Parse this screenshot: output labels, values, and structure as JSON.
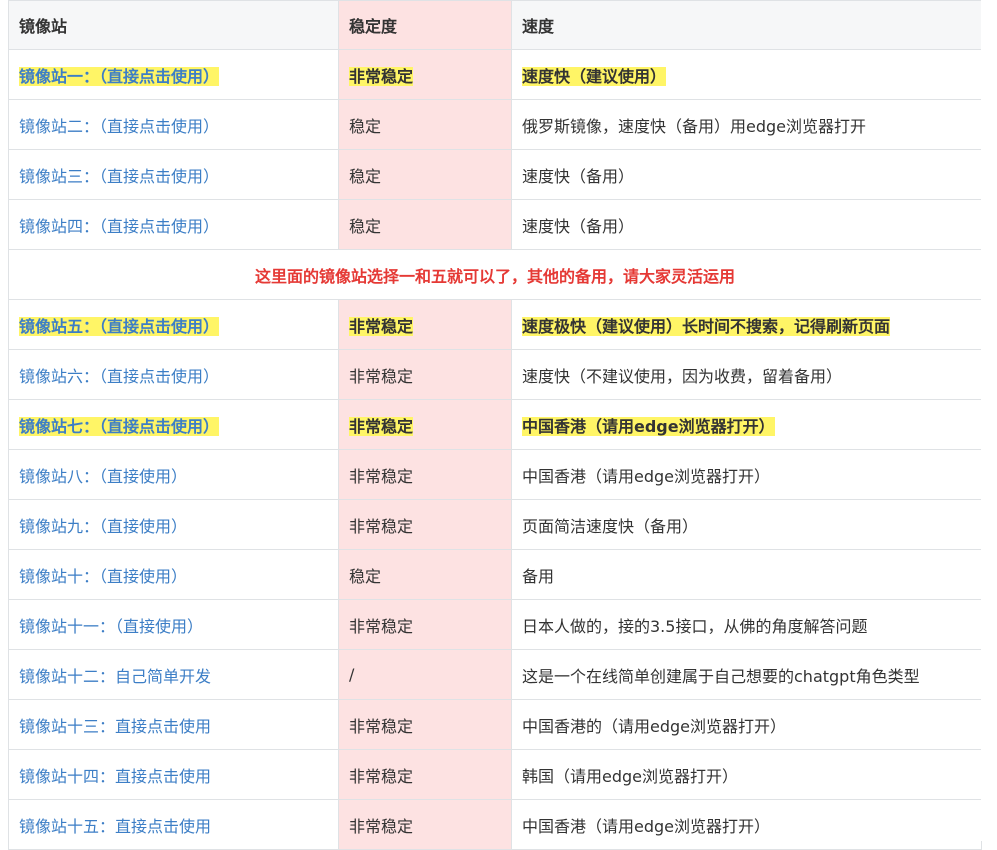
{
  "headers": {
    "mirror": "镜像站",
    "stability": "稳定度",
    "speed": "速度"
  },
  "rows": [
    {
      "name": "镜像站一：（直接点击使用）",
      "stability": "非常稳定",
      "speed": "速度快（建议使用）"
    },
    {
      "name": "镜像站二：（直接点击使用）",
      "stability": "稳定",
      "speed": "俄罗斯镜像，速度快（备用）用edge浏览器打开"
    },
    {
      "name": "镜像站三：（直接点击使用）",
      "stability": "稳定",
      "speed": "速度快（备用）"
    },
    {
      "name": "镜像站四：（直接点击使用）",
      "stability": "稳定",
      "speed": "速度快（备用）"
    },
    {
      "notice": "这里面的镜像站选择一和五就可以了，其他的备用，请大家灵活运用"
    },
    {
      "name": "镜像站五：（直接点击使用）",
      "stability": "非常稳定",
      "speed": "速度极快（建议使用）长时间不搜索，记得刷新页面"
    },
    {
      "name": "镜像站六：（直接点击使用）",
      "stability": "非常稳定",
      "speed": "速度快（不建议使用，因为收费，留着备用）"
    },
    {
      "name": "镜像站七：（直接点击使用）",
      "stability": "非常稳定",
      "speed": "中国香港（请用edge浏览器打开）"
    },
    {
      "name": "镜像站八：（直接使用）",
      "stability": "非常稳定",
      "speed": "中国香港（请用edge浏览器打开）"
    },
    {
      "name": "镜像站九：（直接使用）",
      "stability": "非常稳定",
      "speed": "页面简洁速度快（备用）"
    },
    {
      "name": "镜像站十：（直接使用）",
      "stability": "稳定",
      "speed": "备用"
    },
    {
      "name": "镜像站十一：（直接使用）",
      "stability": "非常稳定",
      "speed": "日本人做的，接的3.5接口，从佛的角度解答问题"
    },
    {
      "name": "镜像站十二：自己简单开发",
      "stability": "/",
      "speed": "这是一个在线简单创建属于自己想要的chatgpt角色类型"
    },
    {
      "name": "镜像站十三：直接点击使用",
      "stability": "非常稳定",
      "speed": "中国香港的（请用edge浏览器打开）"
    },
    {
      "name": "镜像站十四：直接点击使用",
      "stability": "非常稳定",
      "speed": "韩国（请用edge浏览器打开）"
    },
    {
      "name": "镜像站十五：直接点击使用",
      "stability": "非常稳定",
      "speed": "中国香港（请用edge浏览器打开）"
    }
  ],
  "colors": {
    "link": "#3c7ec6",
    "highlight": "#fff566",
    "stability_column": "#fde2e2",
    "notice": "#e53935"
  }
}
